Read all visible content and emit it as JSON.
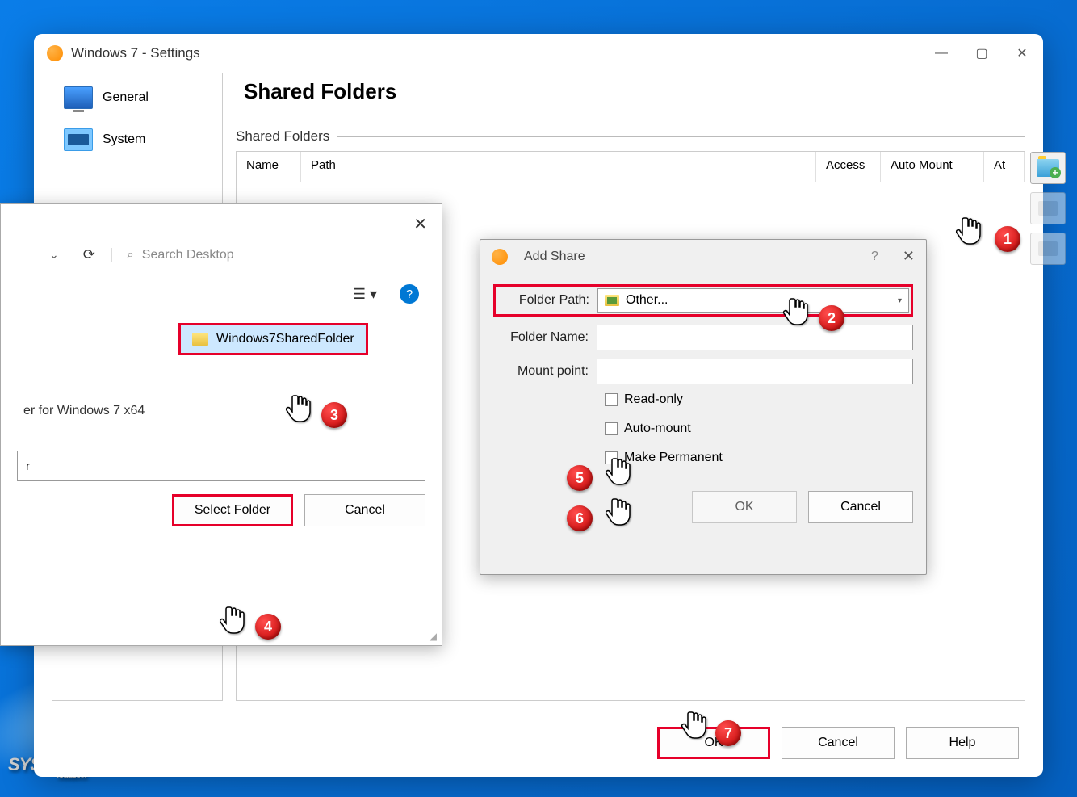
{
  "window": {
    "title": "Windows 7 - Settings"
  },
  "sidebar": {
    "items": [
      {
        "label": "General"
      },
      {
        "label": "System"
      }
    ]
  },
  "main": {
    "heading": "Shared Folders",
    "section_label": "Shared Folders",
    "columns": {
      "name": "Name",
      "path": "Path",
      "access": "Access",
      "automount": "Auto Mount",
      "at": "At"
    }
  },
  "buttons": {
    "ok": "OK",
    "cancel": "Cancel",
    "help": "Help",
    "select_folder": "Select Folder"
  },
  "add_share": {
    "title": "Add Share",
    "folder_path_label": "Folder Path:",
    "folder_path_value": "Other...",
    "folder_name_label": "Folder Name:",
    "mount_point_label": "Mount point:",
    "read_only": "Read-only",
    "auto_mount": "Auto-mount",
    "make_permanent": "Make Permanent"
  },
  "picker": {
    "search_placeholder": "Search Desktop",
    "selected_file": "Windows7SharedFolder",
    "other_item": "er for Windows 7 x64",
    "input_value": "r"
  },
  "watermark": {
    "main": "SYSNETTECH",
    "sub": "Solutions"
  },
  "annotations": {
    "b1": "1",
    "b2": "2",
    "b3": "3",
    "b4": "4",
    "b5": "5",
    "b6": "6",
    "b7": "7"
  }
}
